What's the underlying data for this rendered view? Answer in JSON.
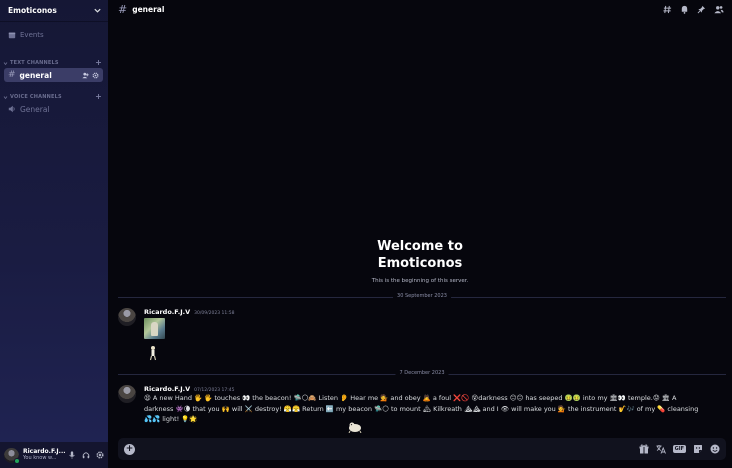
{
  "server": {
    "name": "Emoticonos"
  },
  "sidebar": {
    "events_label": "Events",
    "text_category": "TEXT CHANNELS",
    "voice_category": "VOICE CHANNELS",
    "text_channels": [
      {
        "name": "general"
      }
    ],
    "voice_channels": [
      {
        "name": "General"
      }
    ]
  },
  "user": {
    "name": "Ricardo.F.J...",
    "status": "You know w..."
  },
  "channel": {
    "name": "general"
  },
  "welcome": {
    "line1": "Welcome to",
    "line2": "Emoticonos",
    "subtitle": "This is the beginning of this server."
  },
  "dividers": [
    "30 September 2023",
    "7 December 2023"
  ],
  "messages": [
    {
      "author": "Ricardo.F.J.V",
      "time": "30/09/2023 11:58"
    },
    {
      "author": "Ricardo.F.J.V",
      "time": "07/12/2023 17:45",
      "text": "😫 A new Hand 🖐 🖐 touches 👀 the beacon! 🛸🌕🙈 Listen 👂 Hear me 💁 and obey 🙇 a foul ❌🚫 😵darkness 😑😑 has seeped 🤢🤢 into my 🏛👀 temple.😟 🏛 A darkness 👾🌘 that you 🙌 will ⚔️ destroy! 😤😤 Return ⬅️ my beacon 🛸🌕 to mount 🏔 Kilkreath ⛰⛰ and I 👁 will make you 💁 the instrument 🎷🎶 of my 💊 cleansing 💦💦 light! 💡🌟"
    }
  ],
  "composer": {
    "placeholder": ""
  },
  "icons": {
    "top": [
      "threads-icon",
      "bell-icon",
      "pin-icon",
      "members-icon"
    ],
    "composer": [
      "gift-icon",
      "translate-icon",
      "gif-icon",
      "sticker-icon",
      "emoji-icon"
    ],
    "user_controls": [
      "microphone-icon",
      "headphones-icon",
      "settings-icon"
    ],
    "gif_label": "GIF"
  },
  "colors": {
    "sidebar_top": "#151735",
    "sidebar_bottom": "#202454",
    "active_channel": "#3b3d67",
    "background": "#06060d",
    "online": "#23a55a"
  }
}
